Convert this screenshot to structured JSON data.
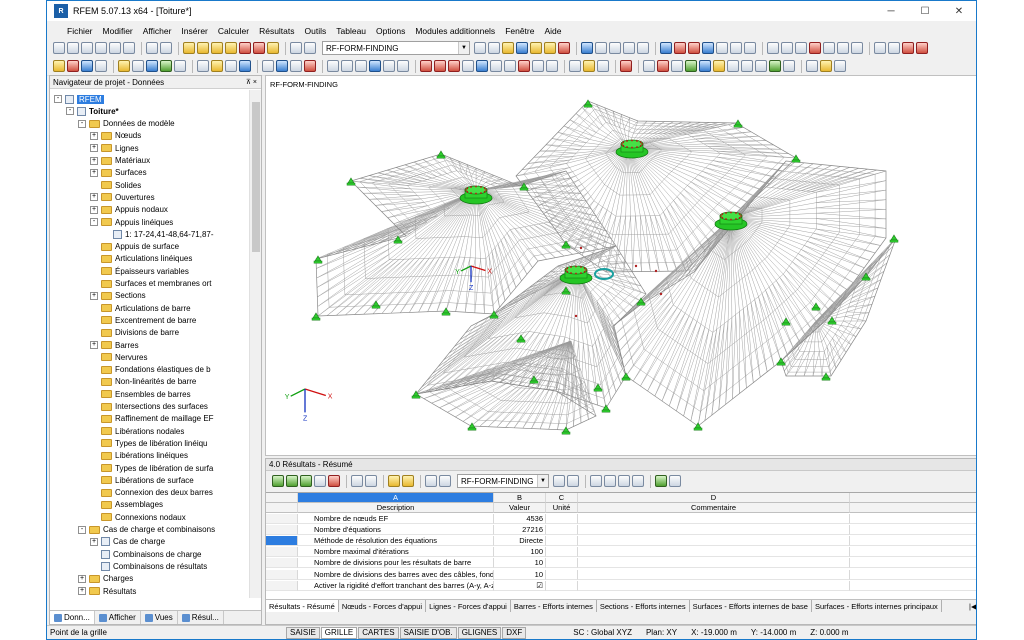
{
  "window": {
    "title": "RFEM 5.07.13 x64 - [Toiture*]",
    "app_icon": "R"
  },
  "menu": [
    "Fichier",
    "Modifier",
    "Afficher",
    "Insérer",
    "Calculer",
    "Résultats",
    "Outils",
    "Tableau",
    "Options",
    "Modules additionnels",
    "Fenêtre",
    "Aide"
  ],
  "toolbar": {
    "case_combo": "RF-FORM-FINDING"
  },
  "navigator": {
    "title": "Navigateur de projet - Données",
    "pin": "⊼ ×",
    "items": [
      {
        "label": "RFEM",
        "level": 0,
        "exp": "-",
        "icon": "doc"
      },
      {
        "label": "Toiture*",
        "level": 1,
        "exp": "-",
        "icon": "doc",
        "bold": true
      },
      {
        "label": "Données de modèle",
        "level": 2,
        "exp": "-",
        "icon": "fold"
      },
      {
        "label": "Nœuds",
        "level": 3,
        "exp": "+",
        "icon": "fold"
      },
      {
        "label": "Lignes",
        "level": 3,
        "exp": "+",
        "icon": "fold"
      },
      {
        "label": "Matériaux",
        "level": 3,
        "exp": "+",
        "icon": "fold"
      },
      {
        "label": "Surfaces",
        "level": 3,
        "exp": "+",
        "icon": "fold"
      },
      {
        "label": "Solides",
        "level": 3,
        "exp": "",
        "icon": "fold"
      },
      {
        "label": "Ouvertures",
        "level": 3,
        "exp": "+",
        "icon": "fold"
      },
      {
        "label": "Appuis nodaux",
        "level": 3,
        "exp": "+",
        "icon": "fold"
      },
      {
        "label": "Appuis linéiques",
        "level": 3,
        "exp": "-",
        "icon": "fold"
      },
      {
        "label": "1: 17-24,41-48,64-71,87-",
        "level": 4,
        "exp": "",
        "icon": "doc"
      },
      {
        "label": "Appuis de surface",
        "level": 3,
        "exp": "",
        "icon": "fold"
      },
      {
        "label": "Articulations linéiques",
        "level": 3,
        "exp": "",
        "icon": "fold"
      },
      {
        "label": "Épaisseurs variables",
        "level": 3,
        "exp": "",
        "icon": "fold"
      },
      {
        "label": "Surfaces et membranes ort",
        "level": 3,
        "exp": "",
        "icon": "fold"
      },
      {
        "label": "Sections",
        "level": 3,
        "exp": "+",
        "icon": "fold"
      },
      {
        "label": "Articulations de barre",
        "level": 3,
        "exp": "",
        "icon": "fold"
      },
      {
        "label": "Excentrement de barre",
        "level": 3,
        "exp": "",
        "icon": "fold"
      },
      {
        "label": "Divisions de barre",
        "level": 3,
        "exp": "",
        "icon": "fold"
      },
      {
        "label": "Barres",
        "level": 3,
        "exp": "+",
        "icon": "fold"
      },
      {
        "label": "Nervures",
        "level": 3,
        "exp": "",
        "icon": "fold"
      },
      {
        "label": "Fondations élastiques de b",
        "level": 3,
        "exp": "",
        "icon": "fold"
      },
      {
        "label": "Non-linéarités de barre",
        "level": 3,
        "exp": "",
        "icon": "fold"
      },
      {
        "label": "Ensembles de barres",
        "level": 3,
        "exp": "",
        "icon": "fold"
      },
      {
        "label": "Intersections des surfaces",
        "level": 3,
        "exp": "",
        "icon": "fold"
      },
      {
        "label": "Raffinement de maillage EF",
        "level": 3,
        "exp": "",
        "icon": "fold"
      },
      {
        "label": "Libérations nodales",
        "level": 3,
        "exp": "",
        "icon": "fold"
      },
      {
        "label": "Types de libération linéiqu",
        "level": 3,
        "exp": "",
        "icon": "fold"
      },
      {
        "label": "Libérations linéiques",
        "level": 3,
        "exp": "",
        "icon": "fold"
      },
      {
        "label": "Types de libération de surfa",
        "level": 3,
        "exp": "",
        "icon": "fold"
      },
      {
        "label": "Libérations de surface",
        "level": 3,
        "exp": "",
        "icon": "fold"
      },
      {
        "label": "Connexion des deux barres",
        "level": 3,
        "exp": "",
        "icon": "fold"
      },
      {
        "label": "Assemblages",
        "level": 3,
        "exp": "",
        "icon": "fold"
      },
      {
        "label": "Connexions nodaux",
        "level": 3,
        "exp": "",
        "icon": "fold"
      },
      {
        "label": "Cas de charge et combinaisons",
        "level": 2,
        "exp": "-",
        "icon": "fold"
      },
      {
        "label": "Cas de charge",
        "level": 3,
        "exp": "+",
        "icon": "doc"
      },
      {
        "label": "Combinaisons de charge",
        "level": 3,
        "exp": "",
        "icon": "doc"
      },
      {
        "label": "Combinaisons de résultats",
        "level": 3,
        "exp": "",
        "icon": "doc"
      },
      {
        "label": "Charges",
        "level": 2,
        "exp": "+",
        "icon": "fold"
      },
      {
        "label": "Résultats",
        "level": 2,
        "exp": "+",
        "icon": "fold"
      }
    ],
    "tabs": [
      "Donn...",
      "Afficher",
      "Vues",
      "Résul..."
    ]
  },
  "view": {
    "label": "RF-FORM-FINDING"
  },
  "results": {
    "title": "4.0 Résultats - Résumé",
    "pin": "⊼ ×",
    "combo": "RF-FORM-FINDING",
    "col_letters": [
      "A",
      "B",
      "C",
      "D"
    ],
    "col_titles": [
      "Description",
      "Valeur",
      "Unité",
      "Commentaire"
    ],
    "rows": [
      {
        "desc": "Nombre de nœuds EF",
        "val": "4536"
      },
      {
        "desc": "Nombre d'équations",
        "val": "27216"
      },
      {
        "desc": "Méthode de résolution des équations",
        "val": "Directe"
      },
      {
        "desc": "Nombre maximal d'itérations",
        "val": "100"
      },
      {
        "desc": "Nombre de divisions pour les résultats de barre",
        "val": "10"
      },
      {
        "desc": "Nombre de divisions des barres avec des câbles, fond",
        "val": "10"
      },
      {
        "desc": "Activer la rigidité d'effort tranchant des barres (A-y, A-z",
        "val": "☑"
      }
    ],
    "tabs": [
      "Résultats - Résumé",
      "Nœuds - Forces d'appui",
      "Lignes - Forces d'appui",
      "Barres - Efforts internes",
      "Sections - Efforts internes",
      "Surfaces - Efforts internes de base",
      "Surfaces - Efforts internes principaux"
    ]
  },
  "statusbar": {
    "left": "Point de la grille",
    "toggles": [
      "SAISIE",
      "GRILLE",
      "CARTES",
      "SAISIE D'OB.",
      "GLIGNES",
      "DXF"
    ],
    "cs": "SC : Global XYZ",
    "plane": "Plan: XY",
    "x": "X: -19.000 m",
    "y": "Y: -14.000 m",
    "z": "Z: 0.000 m"
  }
}
